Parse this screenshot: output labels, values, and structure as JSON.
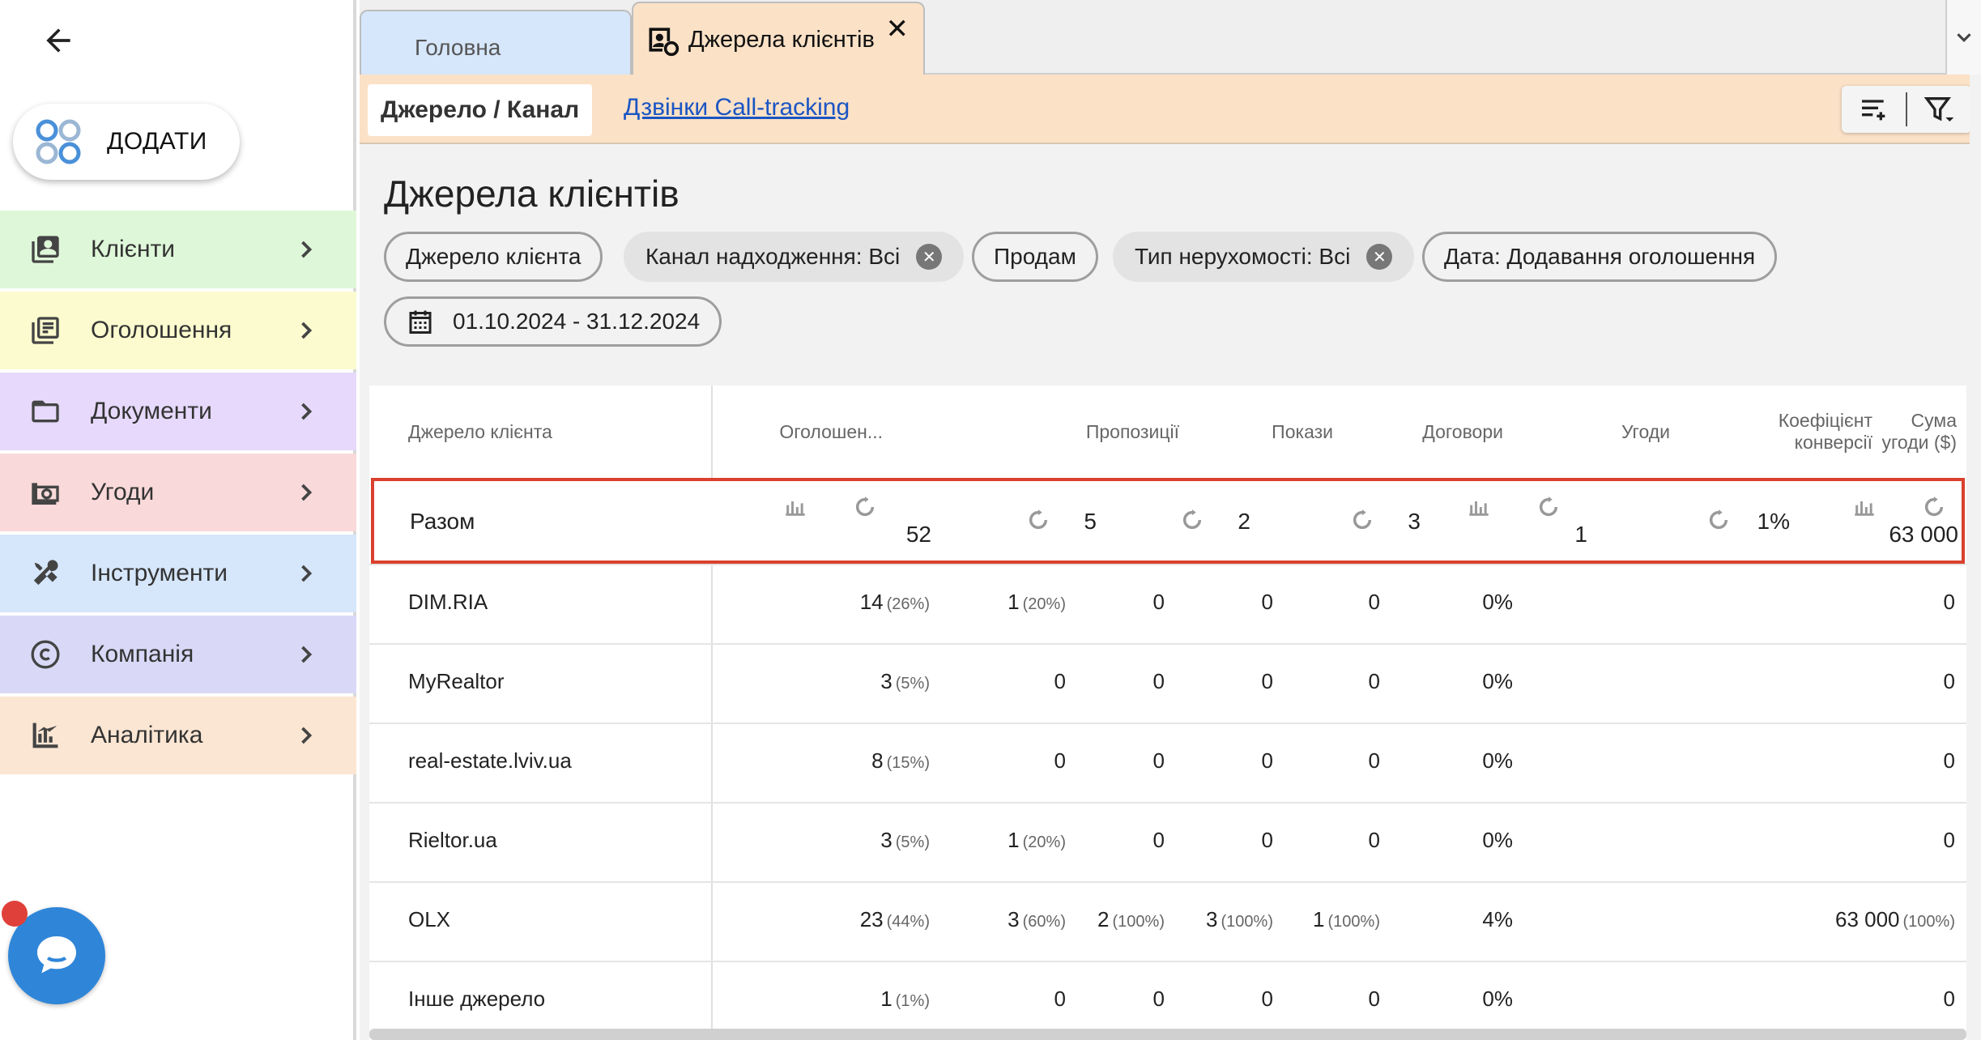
{
  "sidebar": {
    "add_label": "ДОДАТИ",
    "items": [
      {
        "label": "Клієнти",
        "icon": "contacts-icon",
        "color": "#dff7d9"
      },
      {
        "label": "Оголошення",
        "icon": "listing-icon",
        "color": "#fbfbcf"
      },
      {
        "label": "Документи",
        "icon": "folder-icon",
        "color": "#e6d9fb"
      },
      {
        "label": "Угоди",
        "icon": "money-icon",
        "color": "#f9d9d9"
      },
      {
        "label": "Інструменти",
        "icon": "tools-icon",
        "color": "#d6e6fb"
      },
      {
        "label": "Компанія",
        "icon": "copyright-icon",
        "color": "#d9d9f7"
      },
      {
        "label": "Аналітика",
        "icon": "analytics-icon",
        "color": "#fbe6d3"
      }
    ]
  },
  "tabs": {
    "home": "Головна",
    "active": "Джерела клієнтів"
  },
  "subtabs": {
    "active": "Джерело / Канал",
    "link": "Дзвінки Call-tracking"
  },
  "page_title": "Джерела клієнтів",
  "filters": {
    "source": "Джерело клієнта",
    "channel": "Канал надходження: Всі",
    "deal_type": "Продам",
    "property_type": "Тип нерухомості: Всі",
    "date_type": "Дата: Додавання оголошення",
    "date_range": "01.10.2024 - 31.12.2024"
  },
  "table": {
    "headers": {
      "source": "Джерело клієнта",
      "listings": "Оголошен...",
      "offers": "Пропозиції",
      "shows": "Покази",
      "contracts": "Договори",
      "deals": "Угоди",
      "conversion_1": "Коефіцієнт",
      "conversion_2": "конверсії",
      "sum_1": "Сума",
      "sum_2": "угоди ($)"
    },
    "total": {
      "label": "Разом",
      "listings": "52",
      "offers": "5",
      "shows": "2",
      "contracts": "3",
      "deals": "1",
      "conversion": "1%",
      "sum": "63 000"
    },
    "rows": [
      {
        "source": "DIM.RIA",
        "listings": "14",
        "listings_pct": "(26%)",
        "offers": "1",
        "offers_pct": "(20%)",
        "shows": "0",
        "shows_pct": "",
        "contracts": "0",
        "contracts_pct": "",
        "deals": "0",
        "deals_pct": "",
        "conversion": "0%",
        "sum": "0",
        "sum_pct": ""
      },
      {
        "source": "MyRealtor",
        "listings": "3",
        "listings_pct": "(5%)",
        "offers": "0",
        "offers_pct": "",
        "shows": "0",
        "shows_pct": "",
        "contracts": "0",
        "contracts_pct": "",
        "deals": "0",
        "deals_pct": "",
        "conversion": "0%",
        "sum": "0",
        "sum_pct": ""
      },
      {
        "source": "real-estate.lviv.ua",
        "listings": "8",
        "listings_pct": "(15%)",
        "offers": "0",
        "offers_pct": "",
        "shows": "0",
        "shows_pct": "",
        "contracts": "0",
        "contracts_pct": "",
        "deals": "0",
        "deals_pct": "",
        "conversion": "0%",
        "sum": "0",
        "sum_pct": ""
      },
      {
        "source": "Rieltor.ua",
        "listings": "3",
        "listings_pct": "(5%)",
        "offers": "1",
        "offers_pct": "(20%)",
        "shows": "0",
        "shows_pct": "",
        "contracts": "0",
        "contracts_pct": "",
        "deals": "0",
        "deals_pct": "",
        "conversion": "0%",
        "sum": "0",
        "sum_pct": ""
      },
      {
        "source": "OLX",
        "listings": "23",
        "listings_pct": "(44%)",
        "offers": "3",
        "offers_pct": "(60%)",
        "shows": "2",
        "shows_pct": "(100%)",
        "contracts": "3",
        "contracts_pct": "(100%)",
        "deals": "1",
        "deals_pct": "(100%)",
        "conversion": "4%",
        "sum": "63 000",
        "sum_pct": "(100%)"
      },
      {
        "source": "Інше джерело",
        "listings": "1",
        "listings_pct": "(1%)",
        "offers": "0",
        "offers_pct": "",
        "shows": "0",
        "shows_pct": "",
        "contracts": "0",
        "contracts_pct": "",
        "deals": "0",
        "deals_pct": "",
        "conversion": "0%",
        "sum": "0",
        "sum_pct": ""
      }
    ]
  },
  "colors": {
    "accent_orange": "#fbe1c6",
    "tab_home": "#d6e6fb",
    "highlight_border": "#d9412e",
    "link": "#1a55c4",
    "chat": "#2f86d8"
  }
}
